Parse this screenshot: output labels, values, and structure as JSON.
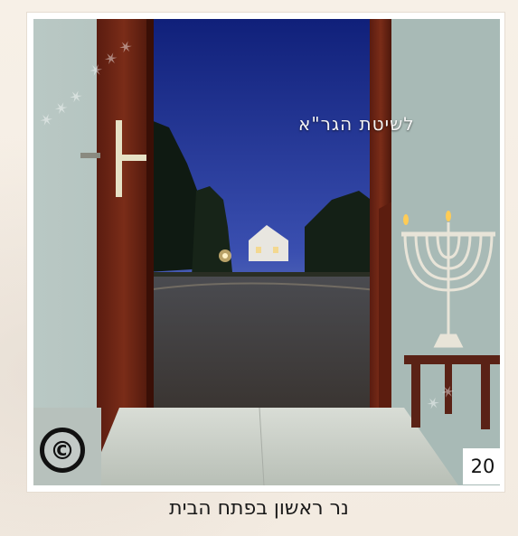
{
  "image": {
    "title_overlay": "לשיטת הגר\"א",
    "page_number": "20",
    "copyright_symbol": "©",
    "caption": "נר ראשון בפתח הבית"
  },
  "colors": {
    "door": "#6b2414",
    "wall": "#aebfbc",
    "sky": "#1a2a8c",
    "floor": "#c9cec8",
    "menorah": "#e8e4d8",
    "table": "#5a2216"
  },
  "icons": {
    "copyright": "copyright-icon",
    "menorah": "menorah-icon",
    "door_handle": "door-handle-icon"
  }
}
